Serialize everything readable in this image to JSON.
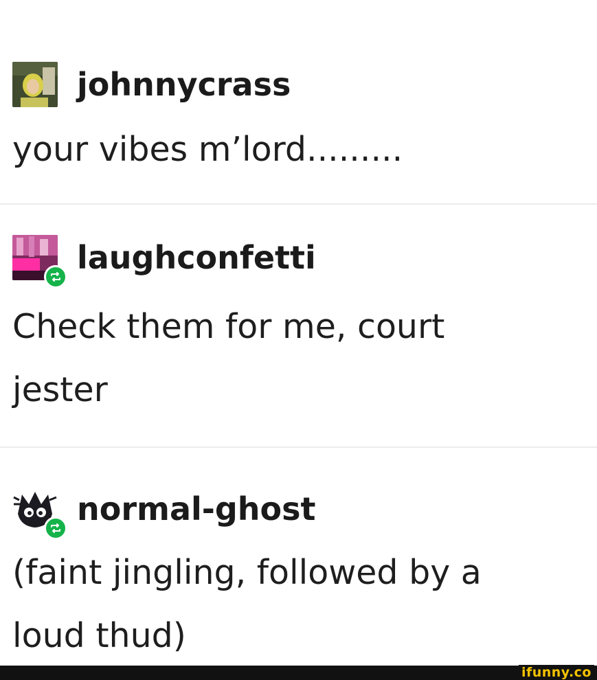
{
  "posts": [
    {
      "username": "johnnycrass",
      "text": "your vibes m’lord.........",
      "avatar_icon": "user-photo-icon",
      "reblog": false
    },
    {
      "username": "laughconfetti",
      "text": "Check them for me, court jester",
      "avatar_icon": "user-photo-icon",
      "reblog": true
    },
    {
      "username": "normal-ghost",
      "text": "(faint jingling, followed by a loud thud)",
      "avatar_icon": "ghost-cat-icon",
      "reblog": true
    }
  ],
  "reblog_icon": "reblog-icon",
  "colors": {
    "reblog_badge": "#15b34a",
    "brand": "#f2c200",
    "footer": "#111111"
  },
  "watermark": {
    "text": "ifunny.co"
  }
}
